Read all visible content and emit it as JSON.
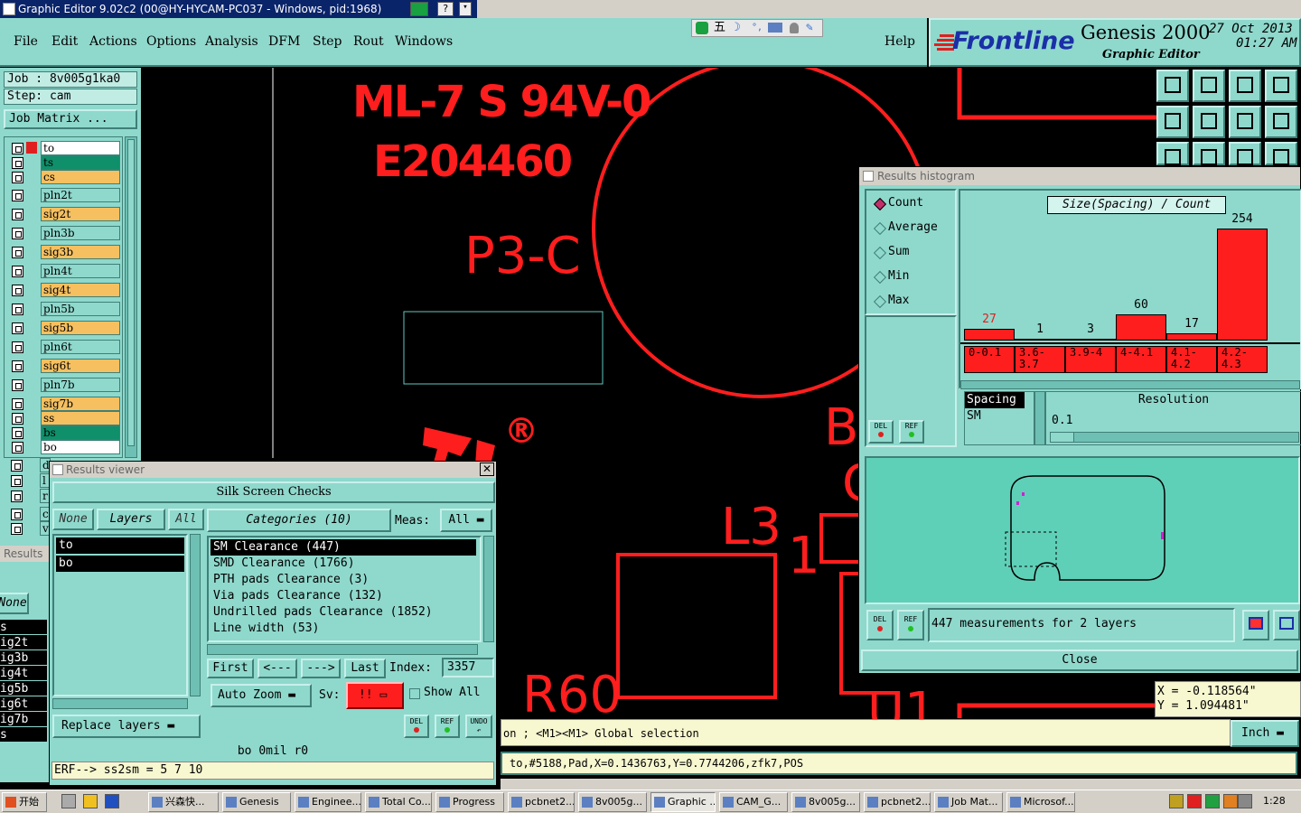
{
  "window": {
    "title": "Graphic Editor 9.02c2 (00@HY-HYCAM-PC037 - Windows, pid:1968)"
  },
  "menu": [
    "File",
    "Edit",
    "Actions",
    "Options",
    "Analysis",
    "DFM",
    "Step",
    "Rout",
    "Windows"
  ],
  "help": "Help",
  "ime": {
    "label": "五"
  },
  "brand": {
    "logo": "Frontline",
    "product": "Genesis 2000",
    "subtitle": "Graphic Editor",
    "date": "27 Oct 2013",
    "time": "01:27 AM"
  },
  "job": {
    "job": "Job : 8v005g1ka0",
    "step": "Step: cam",
    "matrix": "Job Matrix ..."
  },
  "layers": [
    {
      "name": "to",
      "kind": "board"
    },
    {
      "name": "ts",
      "kind": "sig"
    },
    {
      "name": "cs",
      "kind": "board"
    },
    {
      "name": "pln2t",
      "kind": "plane"
    },
    {
      "name": "sig2t",
      "kind": "board"
    },
    {
      "name": "pln3b",
      "kind": "plane"
    },
    {
      "name": "sig3b",
      "kind": "board"
    },
    {
      "name": "pln4t",
      "kind": "plane"
    },
    {
      "name": "sig4t",
      "kind": "board"
    },
    {
      "name": "pln5b",
      "kind": "plane"
    },
    {
      "name": "sig5b",
      "kind": "board"
    },
    {
      "name": "pln6t",
      "kind": "plane"
    },
    {
      "name": "sig6t",
      "kind": "board"
    },
    {
      "name": "pln7b",
      "kind": "plane"
    },
    {
      "name": "sig7b",
      "kind": "board"
    },
    {
      "name": "ss",
      "kind": "board"
    },
    {
      "name": "bs",
      "kind": "sig"
    },
    {
      "name": "bo",
      "kind": "board"
    }
  ],
  "layers_partial": [
    "d",
    "l",
    "r",
    "c",
    "v"
  ],
  "results_bg": {
    "title": "Results",
    "none": "None",
    "items": [
      "s",
      "ig2t",
      "ig3b",
      "ig4t",
      "ig5b",
      "ig6t",
      "ig7b",
      "s"
    ]
  },
  "canvas": {
    "texts": [
      "ML-7 S 94V-0",
      "E204460",
      "P3-C",
      "L3",
      "1",
      "R60",
      "B",
      "C",
      "U1",
      "®"
    ]
  },
  "results_viewer": {
    "title": "Results viewer",
    "header": "Silk Screen Checks",
    "none": "None",
    "layers": "Layers",
    "all": "All",
    "categories": "Categories (10)",
    "meas_label": "Meas:",
    "meas_value": "All",
    "layer_list": [
      "to",
      "bo"
    ],
    "category_list": [
      "SM Clearance (447)",
      "SMD Clearance (1766)",
      "PTH pads Clearance (3)",
      "Via pads Clearance (132)",
      "Undrilled pads Clearance (1852)",
      "Line width (53)"
    ],
    "first": "First",
    "prev": "<---",
    "next": "--->",
    "last": "Last",
    "index_label": "Index:",
    "index_value": "3357",
    "auto_zoom": "Auto Zoom",
    "sv_label": "Sv:",
    "sv_value": "!!",
    "show_all": "Show All",
    "replace_layers": "Replace layers",
    "del": "DEL",
    "ref": "REF",
    "undo": "UNDO",
    "info": "bo 0mil r0",
    "erf": "ERF--> ss2sm = 5 7 10"
  },
  "histogram": {
    "title": "Results histogram",
    "modes": [
      "Count",
      "Average",
      "Sum",
      "Min",
      "Max"
    ],
    "selected_mode": "Count",
    "chart_title": "Size(Spacing) / Count",
    "bins": [
      "0-0.1",
      "3.6-3.7",
      "3.9-4",
      "4-4.1",
      "4.1-4.2",
      "4.2-4.3"
    ],
    "counts": [
      27,
      1,
      3,
      60,
      17,
      254
    ],
    "spacing_label": "Spacing",
    "spacing_sub": "SM",
    "resolution_label": "Resolution",
    "resolution_value": "0.1",
    "measurements": "447 measurements for 2 layers",
    "close": "Close",
    "del": "DEL",
    "ref": "REF"
  },
  "chart_data": {
    "type": "bar",
    "title": "Size(Spacing) / Count",
    "categories": [
      "0-0.1",
      "3.6-3.7",
      "3.9-4",
      "4-4.1",
      "4.1-4.2",
      "4.2-4.3"
    ],
    "values": [
      27,
      1,
      3,
      60,
      17,
      254
    ],
    "ylim": [
      0,
      254
    ]
  },
  "status": {
    "line1": "on ; <M1><M1> Global selection",
    "line2": "to,#5188,Pad,X=0.1436763,Y=0.7744206,zfk7,POS",
    "x": "X = -0.118564\"",
    "y": "Y = 1.094481\"",
    "units": "Inch"
  },
  "taskbar": {
    "start": "开始",
    "items": [
      "兴森快...",
      "Genesis",
      "Enginee...",
      "Total Co...",
      "Progress",
      "pcbnet2...",
      "8v005g...",
      "Graphic ...",
      "CAM_G...",
      "8v005g...",
      "pcbnet2...",
      "Job Mat...",
      "Microsof..."
    ],
    "active": 7,
    "clock": "1:28"
  },
  "colors": {
    "panel": "#8fd8cc",
    "copper": "#ff1e1e",
    "canvas": "#000000",
    "titlebar": "#0a246a"
  }
}
